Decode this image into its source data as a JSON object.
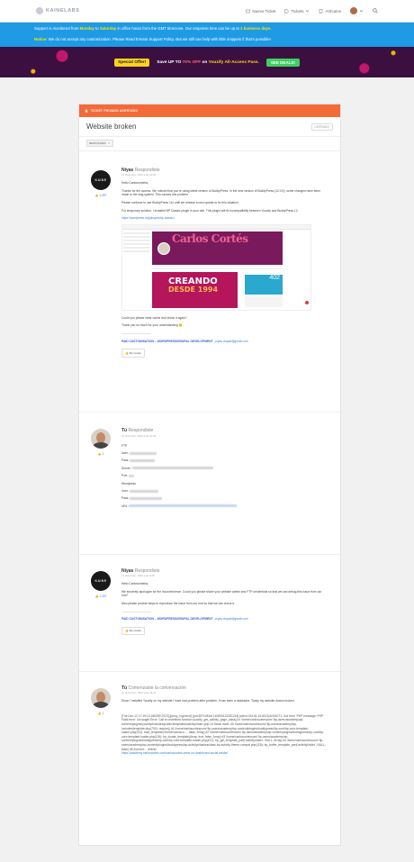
{
  "header": {
    "logo_text": "KAINELABS",
    "nav": [
      {
        "label": "Nuevo Ticket"
      },
      {
        "label": "Tickets"
      },
      {
        "label": "Artículos"
      }
    ]
  },
  "notice": {
    "line1_a": "Support is monitored from ",
    "line1_b": "Monday",
    "line1_c": " to ",
    "line1_d": "Saturday",
    "line1_e": " in office hours from the GMT timezone. Our response time can be up to ",
    "line1_f": "2 business days",
    "line1_g": ".",
    "line2_a": "Notice:",
    "line2_b": " We do not accept any customization. Please Read Envato Support Policy. But we still can help with little snippets if that's possible!"
  },
  "promo": {
    "tag": "Special Offer!",
    "text_a": "Save UP TO ",
    "pct": "70% OFF",
    "text_b": " on ",
    "brand": "Youzify All-Access Pass.",
    "button": "SEE DEALS!"
  },
  "ticket": {
    "banner": "TICKET PRIVADO ACERTADO",
    "title": "Website broken",
    "status": "CERRADO",
    "responses_label": "RESPONSES",
    "responses_count": "5"
  },
  "posts": [
    {
      "author": "Niyas",
      "role": "Respondiste",
      "date": "13 diciembre, 2023 a las 10:06",
      "likes": "1,337",
      "paragraphs": [
        "Hello Carlosromeira,",
        "Thanks for the access. We noticed that you're using latest version of BuddyPress. In the new version of BuddyPress (12.0.0), some changes have been made to the slug system. This causes this problem.",
        "Please continue to use BuddyPress 11x until we release a new update to fix this situation.",
        "For temporary solution, I installed BP Classic plugin in your site. This plugin will fix incompatibility between Youzify and BuddyPress 12.",
        "https://wordpress.org/plugins/bp-classic/",
        "Could you please clear cache and check it again?",
        "Thank you so much for your understanding 😊",
        "——————————"
      ],
      "sig": "PAID CUSTOMISATION – WORDPRESS/DRUPAL DEVELOPMENT",
      "sig_email": " –niyas.drupal@gmail.com",
      "thanks": "Me Gusta",
      "shot": {
        "logo": "Carlos Cortés",
        "ad_big": "CREANDO",
        "ad_small": "DESDE 1994",
        "stat": "402"
      }
    },
    {
      "author": "Tú",
      "role": "Respondiste",
      "date": "13 diciembre, 2023 a las 12:26",
      "likes": "1",
      "fields": [
        "FTP",
        "User:",
        "Pass:",
        "Server:",
        "Port:",
        "Wordpress",
        "User:",
        "Pass:",
        "URL:"
      ]
    },
    {
      "author": "Niyas",
      "role": "Respondiste",
      "date": "13 diciembre, 2023 a las 8:56",
      "likes": "1,337",
      "paragraphs": [
        "Hello Carlosromeira,",
        "We sincerely apologize for the inconvenience. Could you please share your website admin and FTP credentials so that we can debug this issue from our end?",
        "Also please provide steps to reproduce the issue from our end so that we can check it.",
        "——————————"
      ],
      "sig": "PAID CUSTOMISATION – WORDPRESS/DRUPAL DEVELOPMENT",
      "sig_email": " –niyas.drupal@gmail.com",
      "thanks": "Me Gusta"
    },
    {
      "author": "Tú",
      "role": "Comenzaste la conversación",
      "date": "12 diciembre, 2023 a las 18:31",
      "likes": "1",
      "paragraphs": [
        "Since I installed Youzify on my website I have had problem after problem. It has been a headache.  Today my website downs broken."
      ],
      "log": "[Tue Dec 12 17:19:13.166309 2023] [proxy_fcgi:error] [pid 597148:tid 140690122281216] [client 154.61.16.83:0] AH01071: Got error 'PHP message: PHP Fatal error: Uncaught Error: Call to undefined function youzify_get_activity_page_class() in /home/carloscortescom/ ftp-users/academy/wp-content/plugins/youzify/includes/public/templates/activity/index.php:14 Stack trace: #0 /home/carloscortescom/ ftp-users/academy/wp-includes/template.php(792): require() #1 /home/carloscortescom/ ftp-users/academy/wp-content/plugins/buddypress/bp-core/bp-core-template-loader.php(222): load_template('/home/carlosco...', false, Array) #2 /home/carloscortescom/ ftp-users/academy/wp-content/plugins/buddypress/bp-core/bp-core-template-loader.php(125): bp_locate_template(Array, true, false, Array) #3 /home/carloscortescom/ ftp-users/academy/wp-content/plugins/buddypress/bp-core/bp-core-template-loader.php(437): bp_get_template_part('activity/index', NULL, Array) #4 /home/carloscortescom/ ftp-users/academy/wp-content/plugins/buddypress/bp-activity/classes/class-bp-activity-theme-compat.php(118): bp_buffer_template_part('activity/index', NULL, false) #5 /home/c... referer:",
      "log_link": "https://academy.carloscortes.com/carloscortes-crear-un-dashboard-social-media/"
    }
  ]
}
